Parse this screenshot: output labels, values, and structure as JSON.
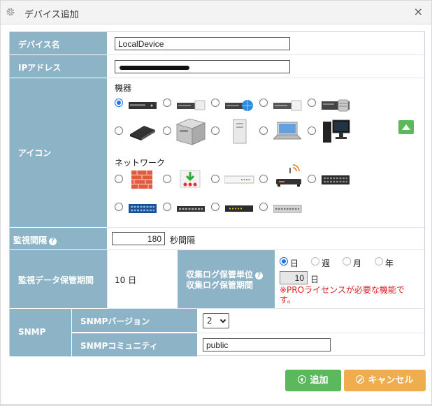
{
  "dialog": {
    "title": "デバイス追加",
    "close_label": "×"
  },
  "form": {
    "device_name": {
      "label": "デバイス名",
      "value": "LocalDevice"
    },
    "ip_address": {
      "label": "IPアドレス"
    },
    "icon": {
      "label": "アイコン",
      "group_devices": "機器",
      "group_network": "ネットワーク",
      "device_icons": [
        "server-rack-1u-icon",
        "server-rack-white-icon",
        "server-rack-globe-icon",
        "server-rack-drive-icon",
        "server-rack-stack-icon",
        "laptop-closed-icon",
        "server-tower-icon",
        "pc-tower-icon",
        "laptop-icon",
        "desktop-pc-icon"
      ],
      "network_icons": [
        "firewall-icon",
        "download-router-icon",
        "switch-white-icon",
        "wifi-router-icon",
        "switch-black-icon",
        "switch-blue-icon",
        "switch-slim-icon",
        "switch-yellow-led-icon",
        "switch-gray-icon"
      ],
      "selected": "server-rack-1u-icon"
    },
    "monitor_interval": {
      "label": "監視間隔",
      "help": "?",
      "value": "180",
      "unit": "秒間隔"
    },
    "retention": {
      "label": "監視データ保管期間",
      "value": "10 日",
      "log_label_line1": "収集ログ保管単位",
      "log_label_line2": "収集ログ保管期間",
      "help": "?",
      "units": [
        "日",
        "週",
        "月",
        "年"
      ],
      "selected_unit": "日",
      "log_period_value": "10",
      "log_period_unit": "日",
      "pro_notice": "※PROライセンスが必要な機能です。"
    },
    "snmp": {
      "label": "SNMP",
      "version_label": "SNMPバージョン",
      "version_value": "2",
      "community_label": "SNMPコミュニティ",
      "community_value": "public"
    }
  },
  "buttons": {
    "add": "追加",
    "cancel": "キャンセル"
  },
  "colors": {
    "label_bg": "#8db3c7",
    "add": "#5cb85c",
    "cancel": "#f0ad4e",
    "notice": "#e02020",
    "radio": "#1a73e8"
  }
}
